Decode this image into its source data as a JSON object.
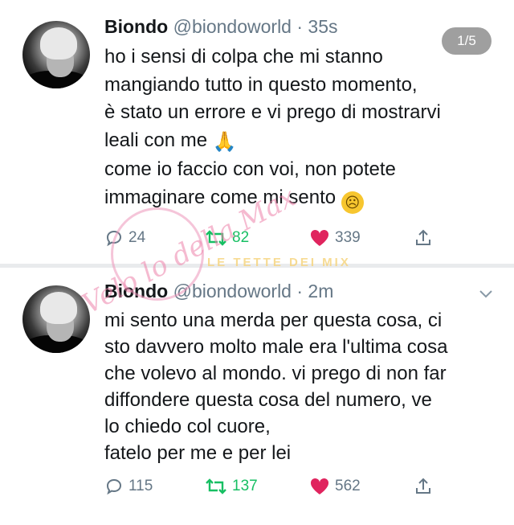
{
  "tweets": [
    {
      "name": "Biondo",
      "handle": "@biondoworld",
      "time": "· 35s",
      "counter": "1/5",
      "lines": [
        "ho i sensi di colpa che mi stanno",
        "mangiando tutto in questo momento,",
        "è stato un errore e vi prego di mostrarvi",
        "leali con me",
        "come io faccio con voi, non potete",
        "immaginare come mi sento"
      ],
      "emoji_line4": "🙏",
      "emoji_line6": "☹",
      "replies": "24",
      "retweets": "82",
      "likes": "339"
    },
    {
      "name": "Biondo",
      "handle": "@biondoworld",
      "time": "· 2m",
      "lines": [
        "mi sento una merda per questa cosa, ci",
        "sto davvero molto male era l'ultima cosa",
        "che volevo al mondo. vi prego di non far",
        "diffondere questa cosa del numero, ve",
        "lo chiedo col cuore,",
        "fatelo per me e per lei"
      ],
      "replies": "115",
      "retweets": "137",
      "likes": "562"
    }
  ],
  "watermarks": {
    "logo_text": "Velo lo della Max",
    "banner_text": "LE TETTE DEI MIX"
  },
  "colors": {
    "text": "#14171a",
    "secondary": "#657786",
    "retweet": "#17bf63",
    "like": "#e0245e"
  },
  "icons": {
    "reply": "reply-icon",
    "retweet": "retweet-icon",
    "like": "heart-icon",
    "share": "share-icon",
    "more": "chevron-down-icon"
  }
}
